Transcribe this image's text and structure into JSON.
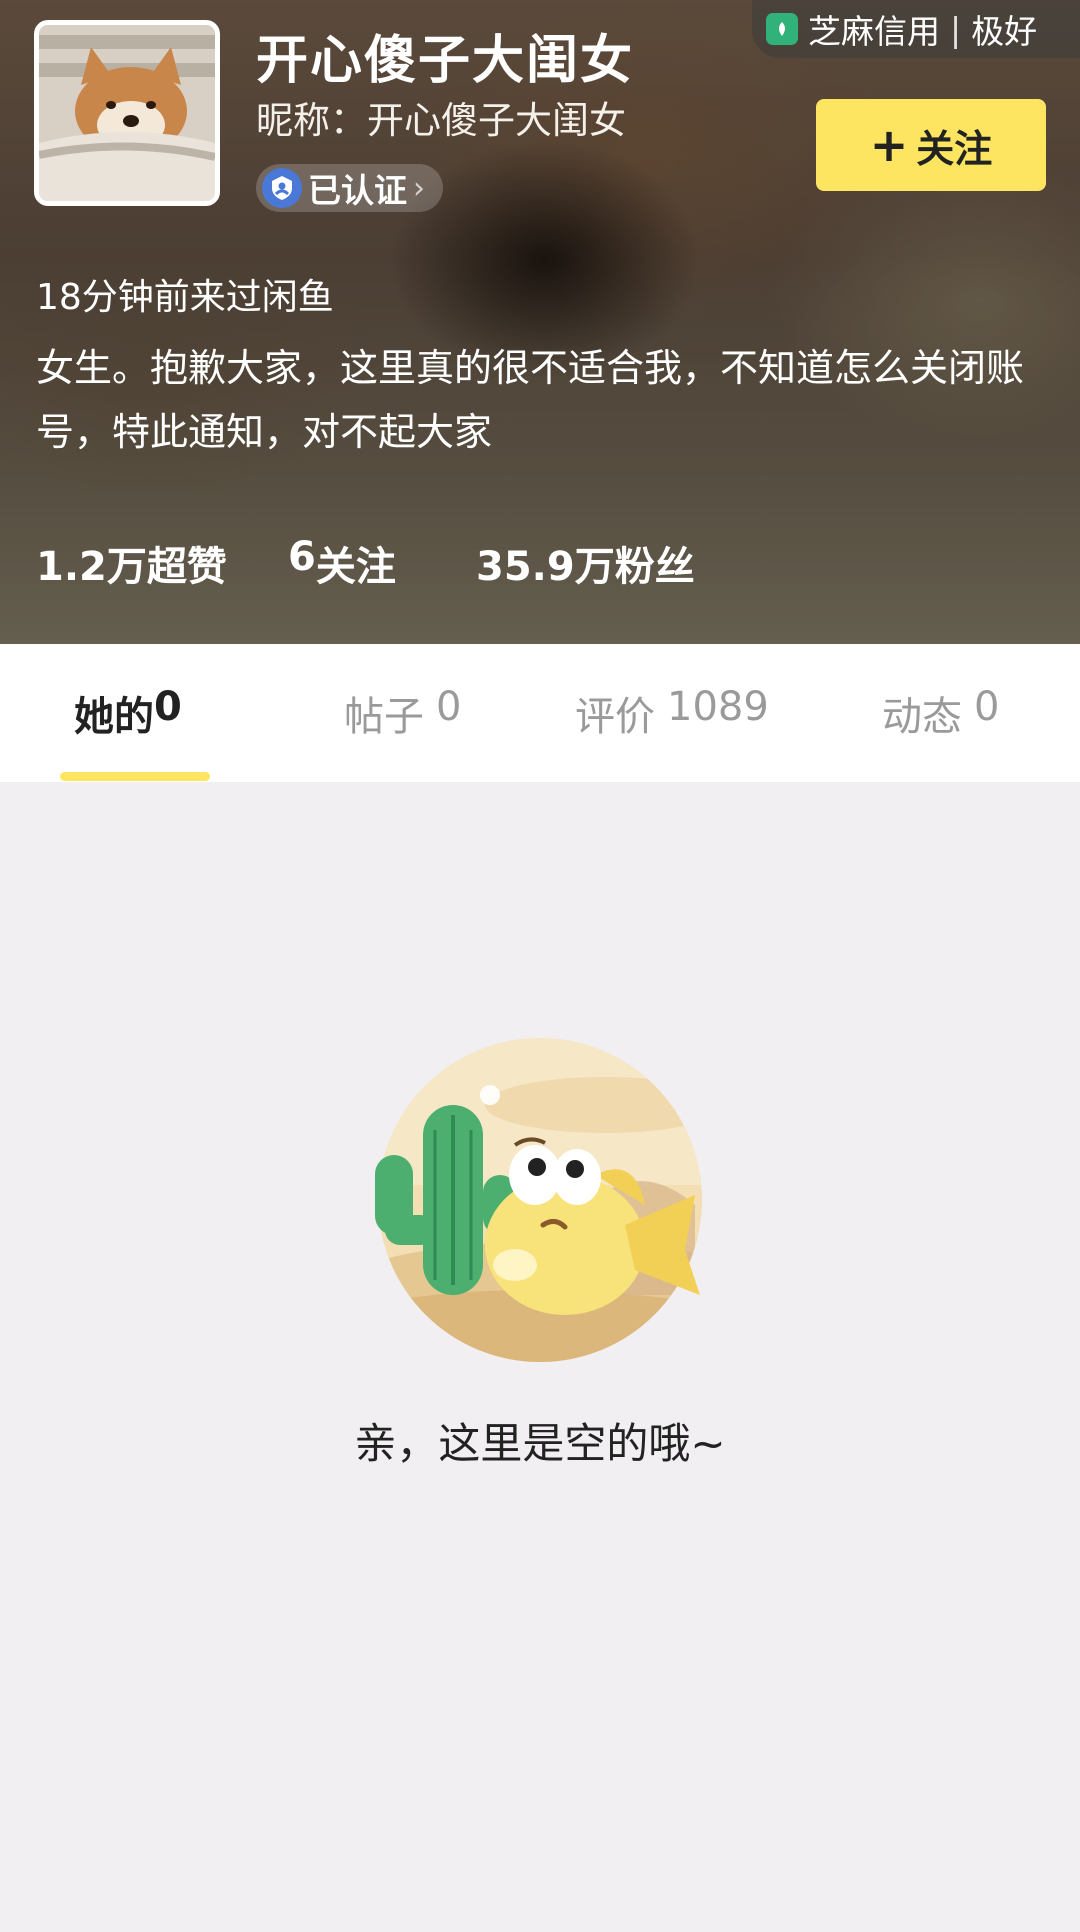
{
  "profile": {
    "username": "开心傻子大闺女",
    "nickname_label": "昵称：",
    "nickname": "开心傻子大闺女",
    "verified_label": "已认证",
    "last_seen": "18分钟前来过闲鱼",
    "bio": "女生。抱歉大家，这里真的很不适合我，不知道怎么关闭账号，特此通知，对不起大家"
  },
  "credit": {
    "label": "芝麻信用",
    "separator": "|",
    "rating": "极好"
  },
  "follow_button": {
    "label": "关注"
  },
  "stats": {
    "likes_value": "1.2万",
    "likes_label": "超赞",
    "following_value": "6",
    "following_label": "关注",
    "followers_value": "35.9万",
    "followers_label": "粉丝"
  },
  "tabs": [
    {
      "label": "她的",
      "count": "0"
    },
    {
      "label": "帖子",
      "count": "0"
    },
    {
      "label": "评价",
      "count": "1089"
    },
    {
      "label": "动态",
      "count": "0"
    }
  ],
  "empty_state": {
    "message": "亲，这里是空的哦~"
  },
  "colors": {
    "accent": "#fde562",
    "background": "#f1eff1",
    "verified_badge": "#4a78d6",
    "credit_icon": "#31b27a"
  },
  "icons": {
    "avatar": "shiba-dog-avatar",
    "verified": "shield-user-icon",
    "credit": "sesame-credit-icon",
    "follow": "plus-icon",
    "empty": "cactus-fish-illustration"
  }
}
